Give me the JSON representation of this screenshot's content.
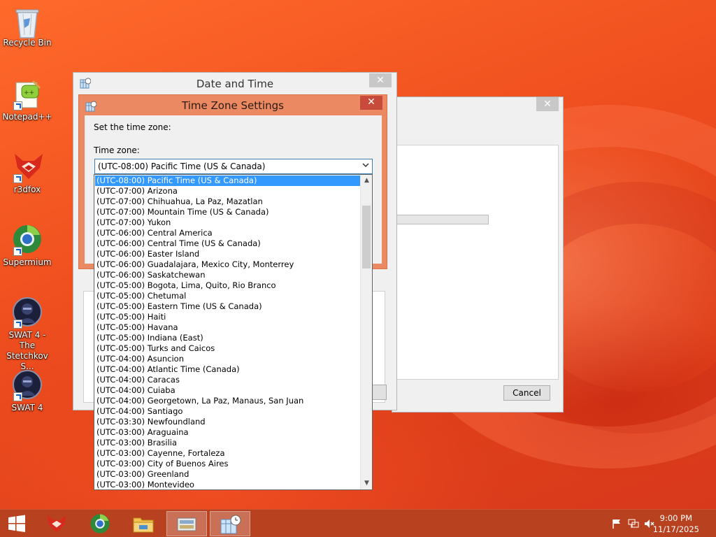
{
  "desktop": {
    "icons": [
      {
        "label": "Recycle Bin",
        "icon": "recycle-bin-icon"
      },
      {
        "label": "Notepad++",
        "icon": "notepad-plus-plus-icon"
      },
      {
        "label": "r3dfox",
        "icon": "r3dfox-icon"
      },
      {
        "label": "Supermium",
        "icon": "supermium-icon"
      },
      {
        "label": "SWAT 4 - The Stetchkov S...",
        "icon": "swat4-stetchkov-icon"
      },
      {
        "label": "SWAT 4",
        "icon": "swat4-icon"
      }
    ]
  },
  "background_dialog": {
    "close": "✕",
    "cancel_label": "Cancel"
  },
  "date_time_window": {
    "title": "Date and Time",
    "close": "✕"
  },
  "tz_window": {
    "title": "Time Zone Settings",
    "close": "✕",
    "instruction": "Set the time zone:",
    "field_label": "Time zone:",
    "selected_value": "(UTC-08:00) Pacific Time (US & Canada)",
    "arrow": "⌄"
  },
  "timezone_list": [
    "(UTC-08:00) Pacific Time (US & Canada)",
    "(UTC-07:00) Arizona",
    "(UTC-07:00) Chihuahua, La Paz, Mazatlan",
    "(UTC-07:00) Mountain Time (US & Canada)",
    "(UTC-07:00) Yukon",
    "(UTC-06:00) Central America",
    "(UTC-06:00) Central Time (US & Canada)",
    "(UTC-06:00) Easter Island",
    "(UTC-06:00) Guadalajara, Mexico City, Monterrey",
    "(UTC-06:00) Saskatchewan",
    "(UTC-05:00) Bogota, Lima, Quito, Rio Branco",
    "(UTC-05:00) Chetumal",
    "(UTC-05:00) Eastern Time (US & Canada)",
    "(UTC-05:00) Haiti",
    "(UTC-05:00) Havana",
    "(UTC-05:00) Indiana (East)",
    "(UTC-05:00) Turks and Caicos",
    "(UTC-04:00) Asuncion",
    "(UTC-04:00) Atlantic Time (Canada)",
    "(UTC-04:00) Caracas",
    "(UTC-04:00) Cuiaba",
    "(UTC-04:00) Georgetown, La Paz, Manaus, San Juan",
    "(UTC-04:00) Santiago",
    "(UTC-03:30) Newfoundland",
    "(UTC-03:00) Araguaina",
    "(UTC-03:00) Brasilia",
    "(UTC-03:00) Cayenne, Fortaleza",
    "(UTC-03:00) City of Buenos Aires",
    "(UTC-03:00) Greenland",
    "(UTC-03:00) Montevideo"
  ],
  "selected_index": 0,
  "scrollbar": {
    "up": "▲",
    "down": "▼"
  },
  "taskbar": {
    "items": [
      "start-button",
      "r3dfox",
      "supermium",
      "file-explorer",
      "control-panel",
      "date-time-settings"
    ],
    "clock_time": "9:00 PM",
    "clock_date": "11/17/2025"
  },
  "colors": {
    "tz_frame": "#eb8a62",
    "selection": "#3399ff",
    "taskbar": "#b8411f"
  }
}
